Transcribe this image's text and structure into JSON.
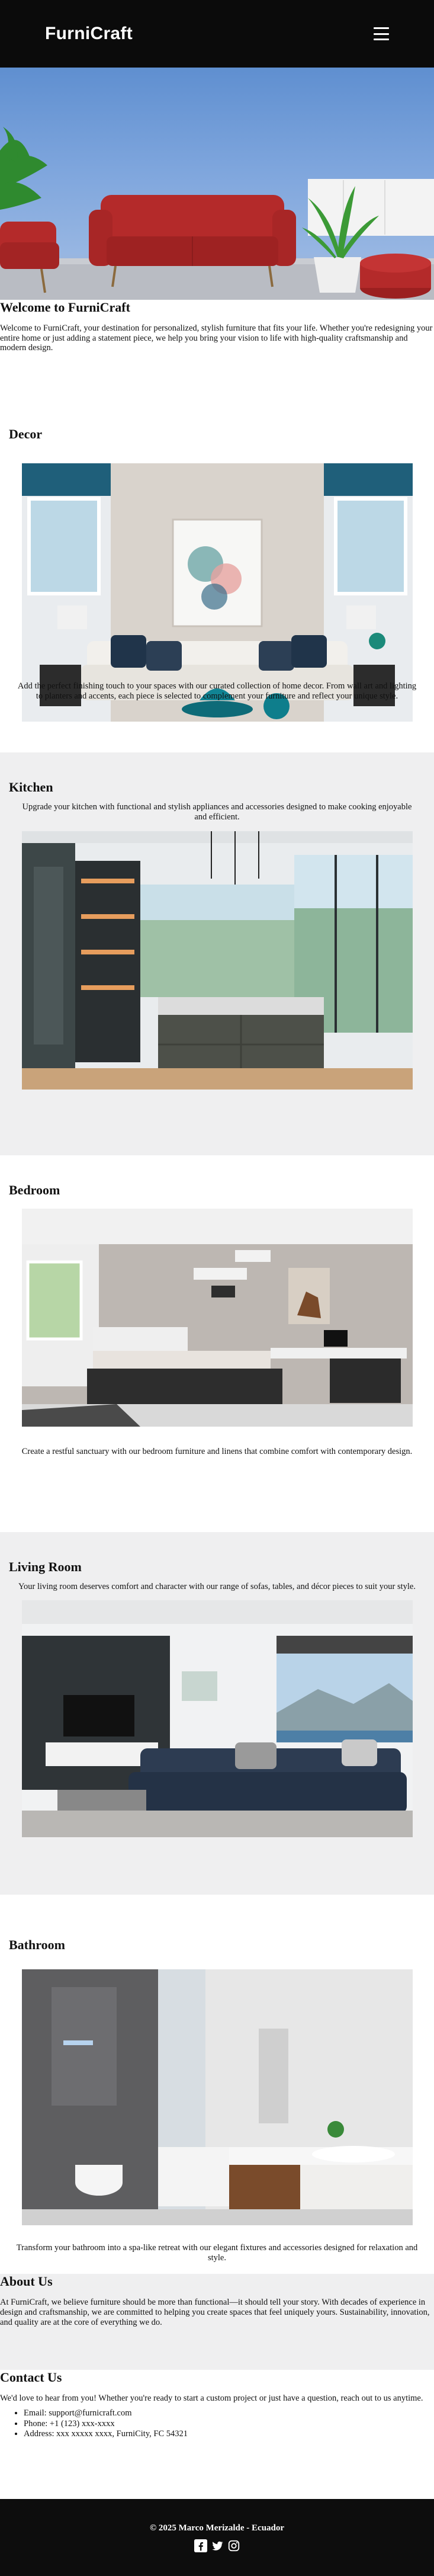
{
  "header": {
    "logo": "FurniCraft",
    "menu_icon": "hamburger-menu-icon"
  },
  "welcome": {
    "title": "Welcome to FurniCraft",
    "text": "Welcome to FurniCraft, your destination for personalized, stylish furniture that fits your life. Whether you're redesigning your entire home or just adding a statement piece, we help you bring your vision to life with high-quality craftsmanship and modern design."
  },
  "decor": {
    "title": "Decor",
    "caption": "Add the perfect finishing touch to your spaces with our curated collection of home decor. From wall art and lighting to planters and accents, each piece is selected to complement your furniture and reflect your unique style."
  },
  "kitchen": {
    "title": "Kitchen",
    "caption": "Upgrade your kitchen with functional and stylish appliances and accessories designed to make cooking enjoyable and efficient."
  },
  "bedroom": {
    "title": "Bedroom",
    "caption": "Create a restful sanctuary with our bedroom furniture and linens that combine comfort with contemporary design."
  },
  "living_room": {
    "title": "Living Room",
    "caption": "Your living room deserves comfort and character with our range of sofas, tables, and décor pieces to suit your style."
  },
  "bathroom": {
    "title": "Bathroom",
    "caption": "Transform your bathroom into a spa-like retreat with our elegant fixtures and accessories designed for relaxation and style."
  },
  "about": {
    "title": "About Us",
    "text": "At FurniCraft, we believe furniture should be more than functional—it should tell your story. With decades of experience in design and craftsmanship, we are committed to helping you create spaces that feel uniquely yours. Sustainability, innovation, and quality are at the core of everything we do."
  },
  "contact": {
    "title": "Contact Us",
    "text": "We'd love to hear from you! Whether you're ready to start a custom project or just have a question, reach out to us anytime.",
    "items": [
      "Email: support@furnicraft.com",
      "Phone: +1 (123) xxx-xxxx",
      "Address: xxx xxxxx xxxx, FurniCity, FC 54321"
    ]
  },
  "footer": {
    "copyright": "© 2025 Marco Merizalde - Ecuador",
    "social_icons": [
      "facebook-icon",
      "twitter-icon",
      "instagram-icon"
    ]
  },
  "colors": {
    "header_bg": "#0b0b0b",
    "sofa_red": "#b42a2a",
    "section_gray": "#efeff0"
  }
}
